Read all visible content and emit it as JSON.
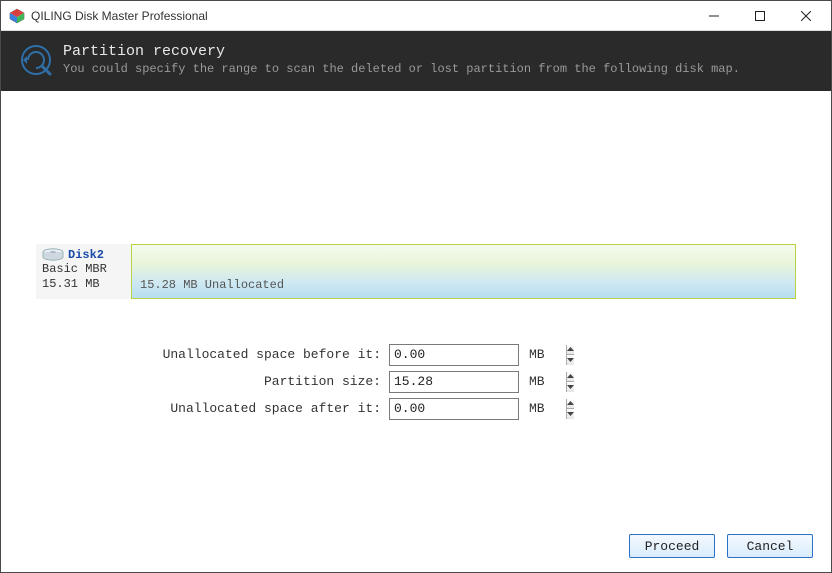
{
  "titlebar": {
    "title": "QILING Disk Master Professional"
  },
  "header": {
    "title": "Partition recovery",
    "subtitle": "You could specify the range to scan the deleted or lost partition from the following disk map."
  },
  "disk": {
    "name": "Disk2",
    "type": "Basic MBR",
    "size": "15.31 MB",
    "partition_label": "15.28 MB Unallocated"
  },
  "form": {
    "before": {
      "label": "Unallocated space before it:",
      "value": "0.00",
      "unit": "MB"
    },
    "size": {
      "label": "Partition size:",
      "value": "15.28",
      "unit": "MB"
    },
    "after": {
      "label": "Unallocated space after it:",
      "value": "0.00",
      "unit": "MB"
    }
  },
  "footer": {
    "proceed": "Proceed",
    "cancel": "Cancel"
  }
}
